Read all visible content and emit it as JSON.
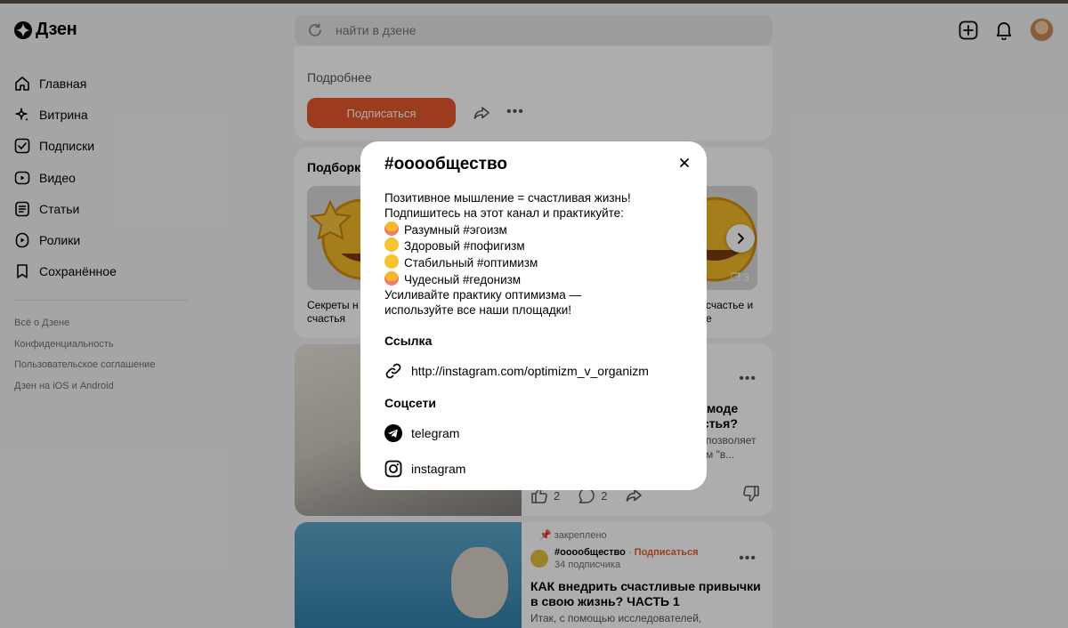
{
  "header": {
    "logo_text": "Дзен",
    "search_placeholder": "найти в дзене"
  },
  "sidebar": {
    "items": [
      {
        "label": "Главная",
        "icon": "home-icon"
      },
      {
        "label": "Витрина",
        "icon": "sparkle-icon"
      },
      {
        "label": "Подписки",
        "icon": "subscriptions-icon"
      },
      {
        "label": "Видео",
        "icon": "video-icon"
      },
      {
        "label": "Статьи",
        "icon": "article-icon"
      },
      {
        "label": "Ролики",
        "icon": "clips-icon"
      },
      {
        "label": "Сохранённое",
        "icon": "bookmark-icon"
      }
    ],
    "footer": [
      "Всё о Дзене",
      "Конфиденциальность",
      "Пользовательское соглашение",
      "Дзен на iOS и Android"
    ]
  },
  "feed": {
    "channel_card": {
      "more_label": "Подробнее",
      "subscribe_label": "Подписаться"
    },
    "selection": {
      "title": "Подборки",
      "left_caption": "Секреты н\nсчастья",
      "right_caption": "счастье и\nе",
      "photo_count": "3"
    },
    "post": {
      "title": "нь моде\nчастья?",
      "text": "позволяет\nм \"в...",
      "likes": "2",
      "comments": "2"
    },
    "pinned_post": {
      "pinned_label": "закреплено",
      "channel": "#ооообщество",
      "separator": " · ",
      "subscribe": "Подписаться",
      "subscribers": "34 подписчика",
      "title": "КАК внедрить счастливые привычки в свою жизнь? ЧАСТЬ 1",
      "text": "Итак, с помощью исследователей,"
    }
  },
  "modal": {
    "title": "#ооообщество",
    "description": [
      "Позитивное мышление = счастливая жизнь!",
      "Подпишитесь на этот канал и практикуйте:",
      "Разумный #эгоизм",
      "Здоровый #пофигизм",
      "Стабильный #оптимизм",
      "Чудесный #гедонизм",
      "Усиливайте практику оптимизма —",
      "используйте все наши площадки!"
    ],
    "link_section": "Ссылка",
    "link_url": "http://instagram.com/optimizm_v_organizm",
    "social_section": "Соцсети",
    "socials": [
      "telegram",
      "instagram"
    ]
  },
  "colors": {
    "accent": "#e6572d",
    "overlay": "rgba(0,0,0,0.32)"
  }
}
